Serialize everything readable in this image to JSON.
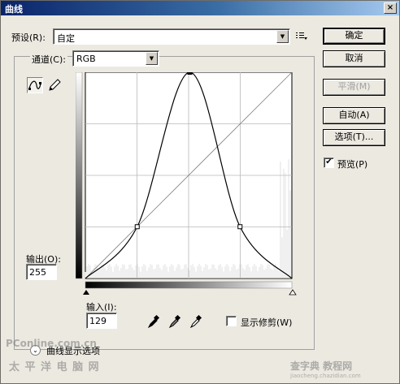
{
  "window": {
    "title": "曲线",
    "close_glyph": "×"
  },
  "preset": {
    "label": "预设(R):",
    "value": "自定"
  },
  "channel": {
    "label": "通道(C):",
    "value": "RGB"
  },
  "buttons": {
    "ok": "确定",
    "cancel": "取消",
    "smooth": "平滑(M)",
    "auto": "自动(A)",
    "options": "选项(T)..."
  },
  "preview": {
    "label": "预览(P)",
    "checked": true
  },
  "output": {
    "label": "输出(O):",
    "value": "255"
  },
  "input": {
    "label": "输入(I):",
    "value": "129"
  },
  "show_clipping": {
    "label": "显示修剪(W)",
    "checked": false
  },
  "curve_display_options": {
    "label": "曲线显示选项"
  },
  "icons": {
    "curve_tool": "curve-point-icon",
    "pencil_tool": "pencil-icon",
    "preset_menu": "preset-options-icon",
    "eyedroppers": [
      "black-eyedropper-icon",
      "gray-eyedropper-icon",
      "white-eyedropper-icon"
    ]
  },
  "curve": {
    "points": [
      [
        0,
        0
      ],
      [
        64,
        64
      ],
      [
        129,
        255
      ],
      [
        191,
        64
      ],
      [
        255,
        0
      ]
    ]
  },
  "watermarks": {
    "left": "PConline.com.cn",
    "left_sub": "太 平 洋 电 脑 网",
    "right": "查字典 教程网",
    "right_sub": "jiaocheng.chazidian.com"
  }
}
